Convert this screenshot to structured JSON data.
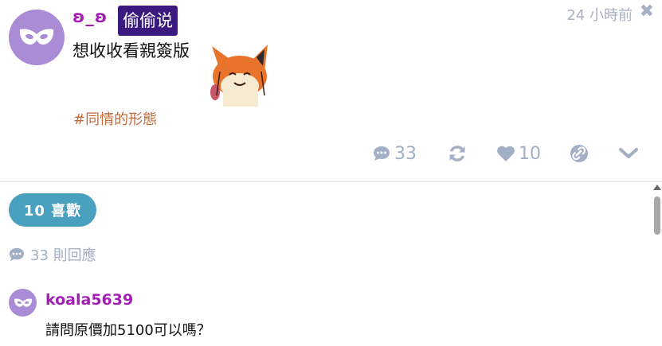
{
  "post": {
    "author": "ʚ_ʚ",
    "badge": "偷偷说",
    "timestamp": "24 小時前",
    "close_glyph": "✖",
    "content": "想收收看親簽版",
    "hashtag": "#同情的形態",
    "avatar_icon": "mask-icon",
    "sticker_icon": "fox-sticker",
    "actions": {
      "comment_count": "33",
      "like_count": "10"
    }
  },
  "likes_summary": {
    "label": "10 喜歡"
  },
  "replies": {
    "count_label": "33 則回應"
  },
  "comments": [
    {
      "author": "koala5639",
      "text": "請問原價加5100可以嗎？",
      "avatar_icon": "mask-icon"
    }
  ],
  "colors": {
    "author": "#a31fb3",
    "badge_bg": "#3b1a7f",
    "hashtag": "#c06a3c",
    "icon_gray": "#a3afc4",
    "likes_pill": "#4aa0bf",
    "avatar_bg": "#a98bd6"
  }
}
